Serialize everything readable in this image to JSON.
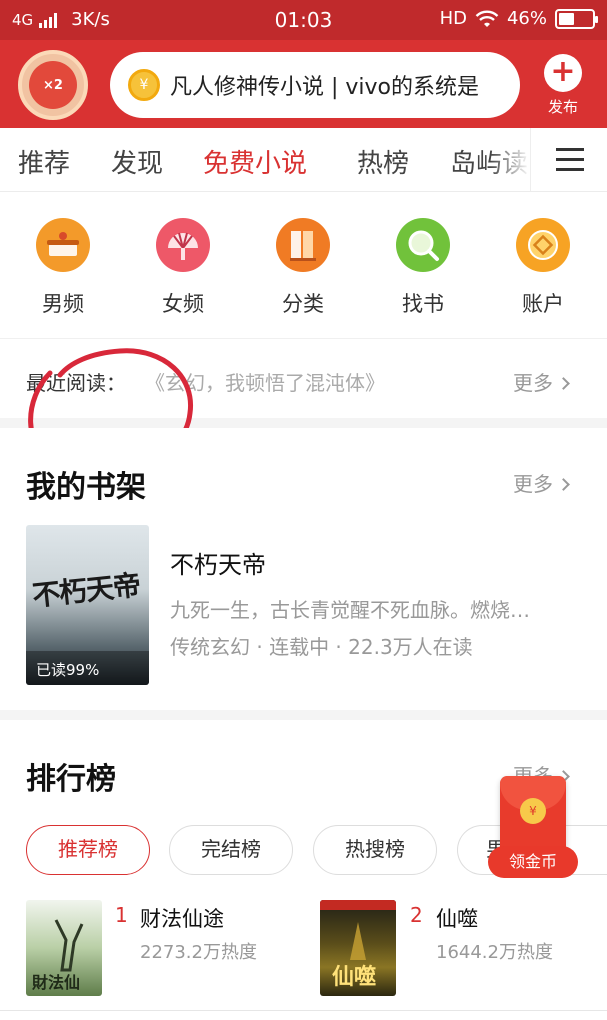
{
  "status_bar": {
    "network": "4G",
    "speed": "3K/s",
    "time": "01:03",
    "hd": "HD",
    "battery": "46%",
    "battery_level": 0.46
  },
  "header": {
    "avatar_badge": "×2",
    "search_text": "凡人修神传小说 | vivo的系统是",
    "coin_symbol": "¥",
    "publish_label": "发布"
  },
  "tabs": [
    {
      "label": "推荐"
    },
    {
      "label": "发现"
    },
    {
      "label": "免费小说"
    },
    {
      "label": "热榜"
    },
    {
      "label": "岛屿读"
    }
  ],
  "active_tab": "免费小说",
  "quick_entries": [
    {
      "label": "男频",
      "icon": "male-channel-icon",
      "color": "#f39a2a"
    },
    {
      "label": "女频",
      "icon": "female-channel-icon",
      "color": "#ee5868"
    },
    {
      "label": "分类",
      "icon": "category-icon",
      "color": "#f07b24"
    },
    {
      "label": "找书",
      "icon": "find-book-icon",
      "color": "#71c23b"
    },
    {
      "label": "账户",
      "icon": "account-icon",
      "color": "#f7a324"
    }
  ],
  "recent_reading": {
    "label": "最近阅读：",
    "book": "《玄幻，我顿悟了混沌体》",
    "more": "更多"
  },
  "bookshelf": {
    "title": "我的书架",
    "more": "更多",
    "book": {
      "cover_title": "不朽天帝",
      "progress_badge": "已读99%",
      "title": "不朽天帝",
      "description": "九死一生，古长青觉醒不死血脉。燃烧…",
      "meta": "传统玄幻 · 连载中 · 22.3万人在读"
    }
  },
  "ranking": {
    "title": "排行榜",
    "more": "更多",
    "tabs": [
      "推荐榜",
      "完结榜",
      "热搜榜",
      "男"
    ],
    "active_tab": "推荐榜",
    "items": [
      {
        "rank": "1",
        "title": "财法仙途",
        "heat": "2273.2万热度",
        "cover_color": "#8fb07a"
      },
      {
        "rank": "2",
        "title": "仙噬",
        "heat": "1644.2万热度",
        "cover_color": "#3b3a1d"
      }
    ]
  },
  "floating_packet": {
    "label": "领金币",
    "coin_symbol": "¥"
  },
  "colors": {
    "brand_red": "#d93232",
    "status_red": "#c02a2c"
  }
}
